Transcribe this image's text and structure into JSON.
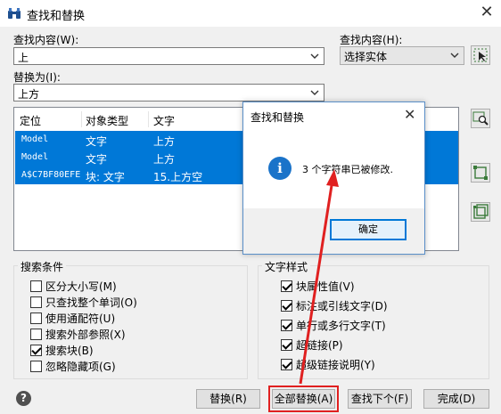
{
  "window": {
    "title": "查找和替换",
    "close_glyph": "✕"
  },
  "find": {
    "label": "查找内容(W):",
    "value": "上"
  },
  "replace": {
    "label": "替换为(I):",
    "value": "上方"
  },
  "find_where": {
    "label": "查找内容(H):",
    "value": "选择实体"
  },
  "results": {
    "columns": [
      "定位",
      "对象类型",
      "文字"
    ],
    "rows": [
      {
        "location": "Model",
        "type": "文字",
        "text": "上方"
      },
      {
        "location": "Model",
        "type": "文字",
        "text": "上方"
      },
      {
        "location": "A$C7BF80EFE",
        "type": "块: 文字",
        "text": "15.上方空"
      }
    ]
  },
  "search_options": {
    "title": "搜索条件",
    "items": [
      {
        "label": "区分大小写(M)",
        "checked": false
      },
      {
        "label": "只查找整个单词(O)",
        "checked": false
      },
      {
        "label": "使用通配符(U)",
        "checked": false
      },
      {
        "label": "搜索外部参照(X)",
        "checked": false
      },
      {
        "label": "搜索块(B)",
        "checked": true
      },
      {
        "label": "忽略隐藏项(G)",
        "checked": false
      }
    ]
  },
  "text_types": {
    "title": "文字样式",
    "items": [
      {
        "label": "块属性值(V)",
        "checked": true
      },
      {
        "label": "标注或引线文字(D)",
        "checked": true
      },
      {
        "label": "单行或多行文字(T)",
        "checked": true
      },
      {
        "label": "超链接(P)",
        "checked": true
      },
      {
        "label": "超级链接说明(Y)",
        "checked": true
      }
    ]
  },
  "buttons": {
    "help": "?",
    "replace": "替换(R)",
    "replace_all": "全部替换(A)",
    "find_next": "查找下个(F)",
    "done": "完成(D)"
  },
  "message_box": {
    "title": "查找和替换",
    "close_glyph": "✕",
    "icon": "info-icon",
    "icon_glyph": "i",
    "text": "3 个字符串已被修改.",
    "ok": "确定"
  },
  "colors": {
    "selection": "#0078d7",
    "annotation": "#e02020",
    "info": "#1a73c9"
  }
}
